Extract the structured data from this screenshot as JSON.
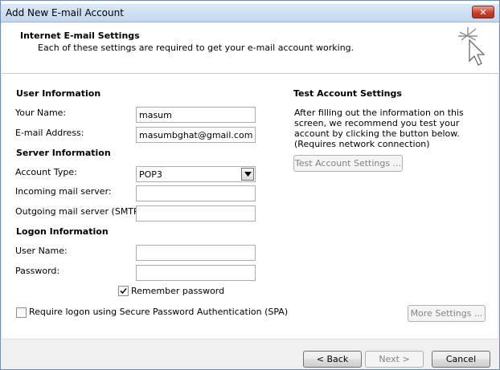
{
  "window": {
    "title": "Add New E-mail Account",
    "close_label": "✕"
  },
  "header": {
    "title": "Internet E-mail Settings",
    "subtitle": "Each of these settings are required to get your e-mail account working.",
    "icon": "cursor-sparkle-icon"
  },
  "user_info": {
    "heading": "User Information",
    "name_label": "Your Name:",
    "name_value": "masum",
    "email_label": "E-mail Address:",
    "email_value": "masumbghat@gmail.com"
  },
  "server_info": {
    "heading": "Server Information",
    "account_type_label": "Account Type:",
    "account_type_value": "POP3",
    "incoming_label": "Incoming mail server:",
    "incoming_value": "",
    "outgoing_label": "Outgoing mail server (SMTP):",
    "outgoing_value": ""
  },
  "logon_info": {
    "heading": "Logon Information",
    "username_label": "User Name:",
    "username_value": "",
    "password_label": "Password:",
    "password_value": "",
    "remember_label": "Remember password",
    "remember_checked": true,
    "spa_label": "Require logon using Secure Password Authentication (SPA)",
    "spa_checked": false
  },
  "test_settings": {
    "heading": "Test Account Settings",
    "description": "After filling out the information on this screen, we recommend you test your account by clicking the button below. (Requires network connection)",
    "test_button": "Test Account Settings ..."
  },
  "buttons": {
    "more_settings": "More Settings ...",
    "back": "< Back",
    "next": "Next >",
    "cancel": "Cancel"
  }
}
